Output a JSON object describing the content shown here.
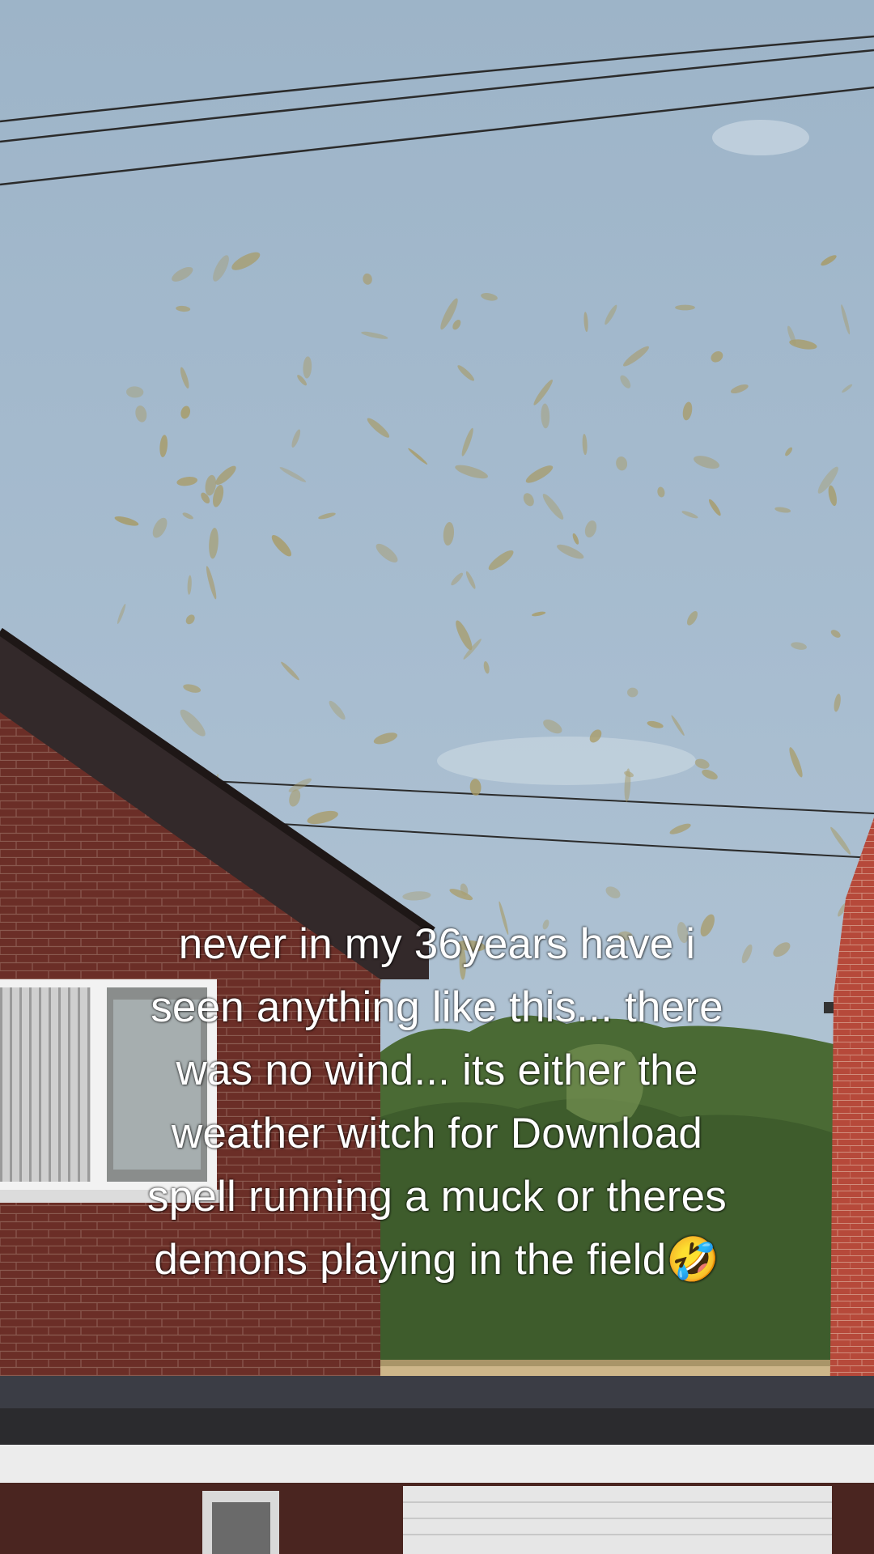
{
  "caption": {
    "lines": [
      "never in my 36years have i",
      "seen anything like this... there",
      "was no wind... its either the",
      "weather witch for Download",
      "spell running a muck or theres",
      "demons playing in the field🤣"
    ]
  },
  "colors": {
    "sky": "#a8bdd0",
    "brick": "#6e2f28",
    "roof": "#3a2f2c",
    "foliage": "#4d6b35",
    "field": "#cdb689",
    "seeds": "#a89a63"
  }
}
